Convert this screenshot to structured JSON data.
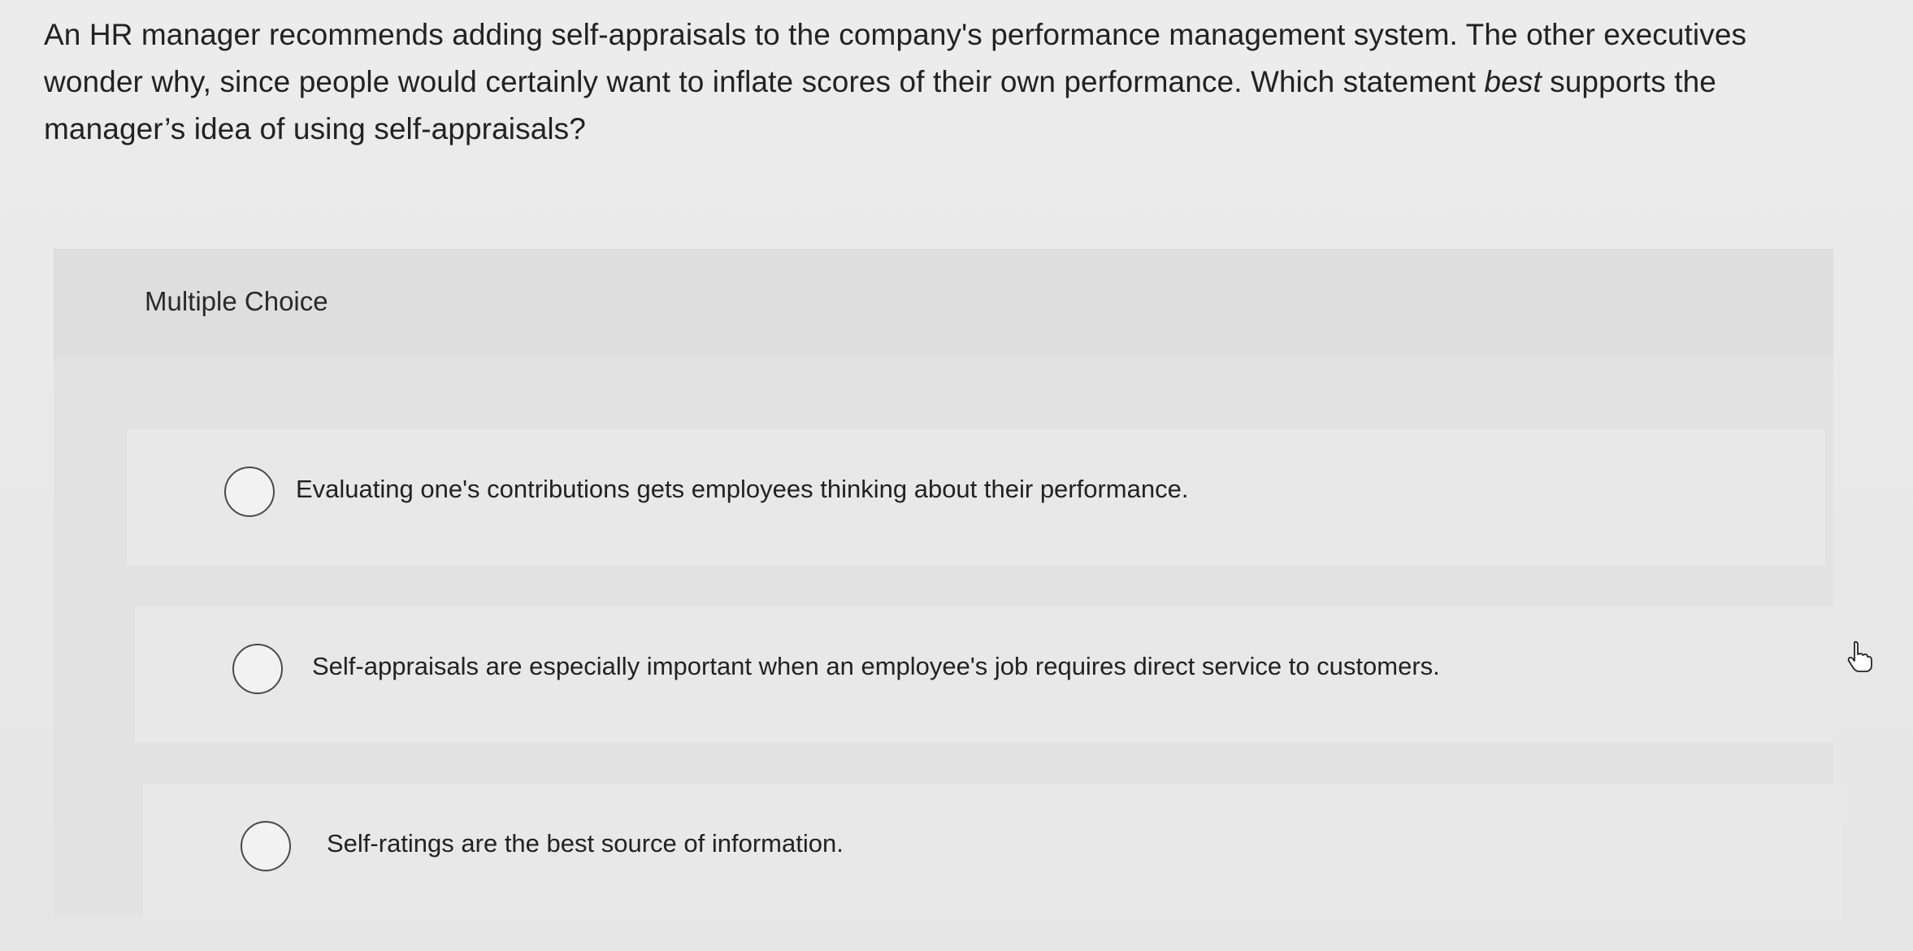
{
  "question": {
    "part1": "An HR manager recommends adding self-appraisals to the company's performance management system. The other executives wonder why, since people would certainly want to inflate scores of their own performance. Which statement ",
    "emphasis": "best",
    "part2": " supports the manager’s idea of using self-appraisals?"
  },
  "choice_section": {
    "heading": "Multiple Choice"
  },
  "options": [
    {
      "label": "Evaluating one's contributions gets employees thinking about their performance."
    },
    {
      "label": "Self-appraisals are especially important when an employee's job requires direct service to customers."
    },
    {
      "label": "Self-ratings are the best source of information."
    }
  ],
  "icons": {
    "radio": "radio-circle-icon",
    "cursor": "hand-pointer-icon"
  }
}
